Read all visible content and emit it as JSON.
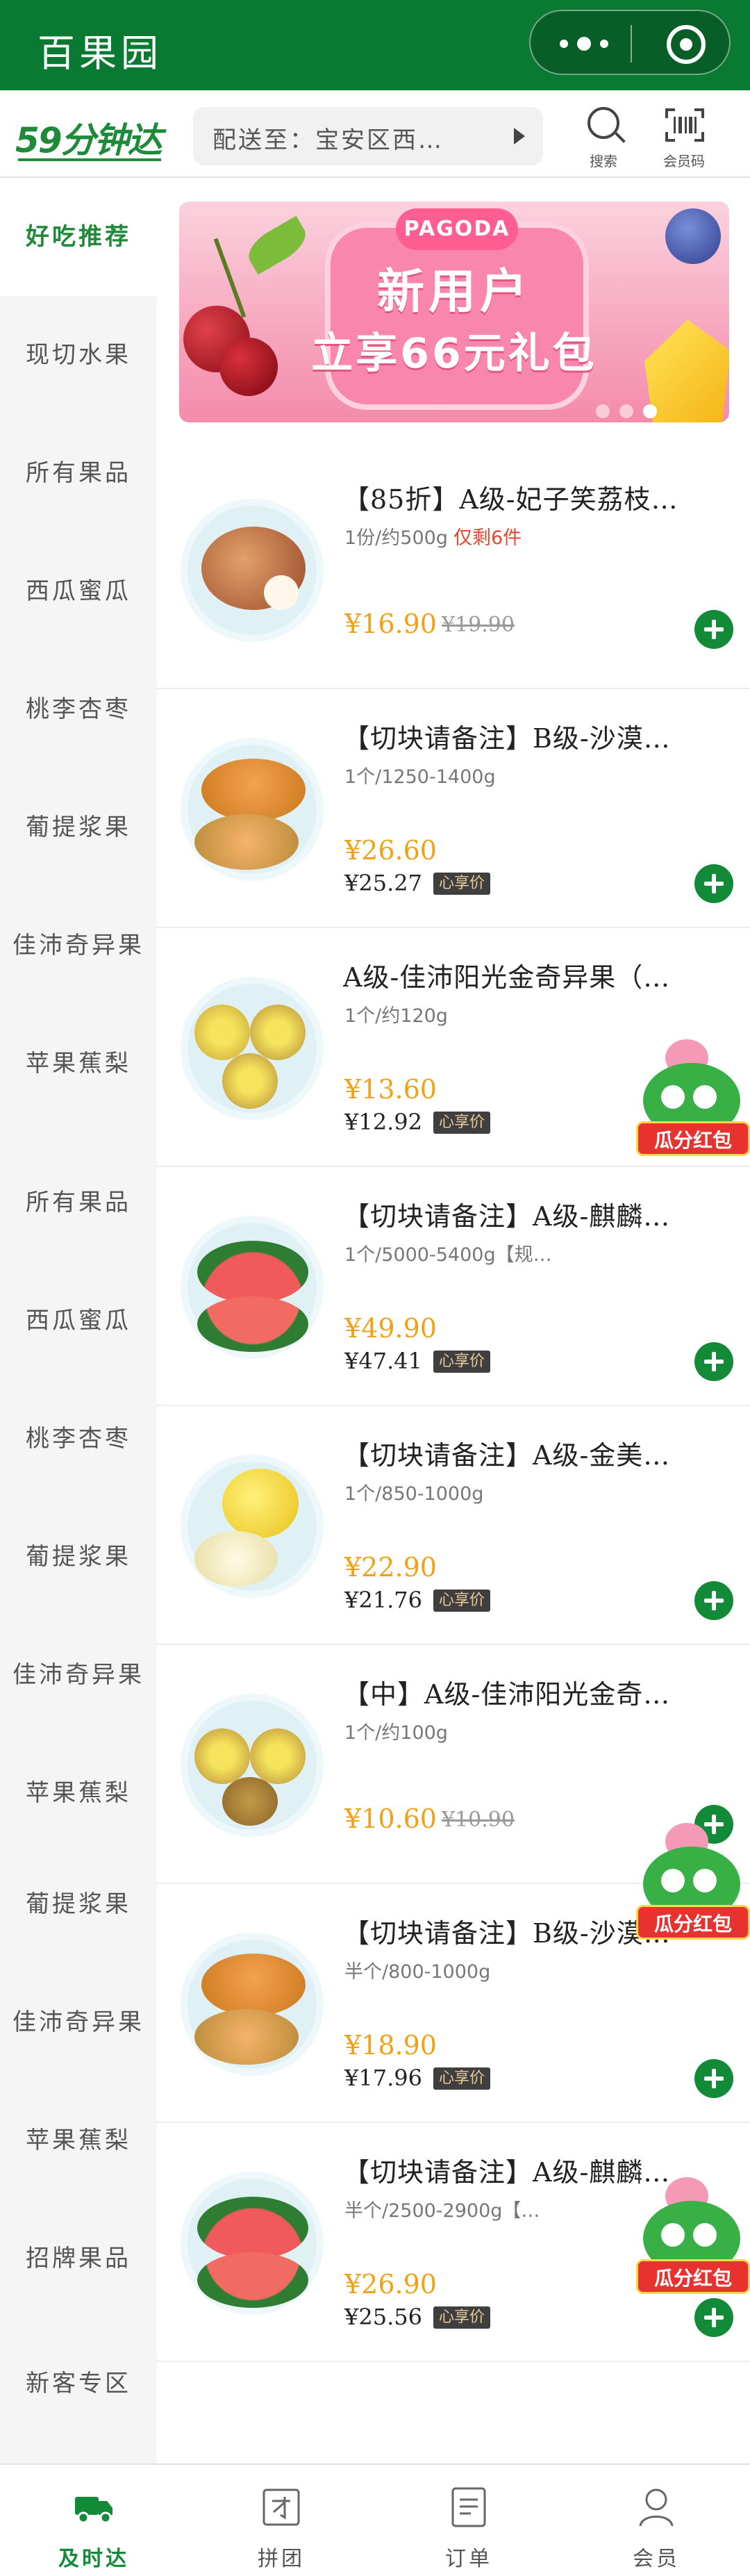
{
  "app": {
    "title": "百果园"
  },
  "header": {
    "brand": "59分钟达",
    "address": "配送至：宝安区西…",
    "search_label": "搜索",
    "member_code_label": "会员码"
  },
  "sidebar": {
    "items": [
      {
        "label": "好吃推荐",
        "active": true
      },
      {
        "label": "现切水果"
      },
      {
        "label": "所有果品"
      },
      {
        "label": "西瓜蜜瓜"
      },
      {
        "label": "桃李杏枣"
      },
      {
        "label": "葡提浆果"
      },
      {
        "label": "佳沛奇异果"
      },
      {
        "label": "苹果蕉梨"
      },
      {
        "label": "所有果品"
      },
      {
        "label": "西瓜蜜瓜"
      },
      {
        "label": "桃李杏枣"
      },
      {
        "label": "葡提浆果"
      },
      {
        "label": "佳沛奇异果"
      },
      {
        "label": "苹果蕉梨"
      },
      {
        "label": "葡提浆果"
      },
      {
        "label": "佳沛奇异果"
      },
      {
        "label": "苹果蕉梨"
      },
      {
        "label": "招牌果品"
      },
      {
        "label": "新客专区"
      }
    ]
  },
  "banner": {
    "brand": "PAGODA",
    "line1": "新用户",
    "line2": "立享66元礼包"
  },
  "products": [
    {
      "title": "【85折】A级-妃子笑荔枝…",
      "spec": "1份/约500g",
      "limit": "仅剩6件",
      "price": "¥16.90",
      "original": "¥19.90"
    },
    {
      "title": "【切块请备注】B级-沙漠…",
      "spec": "1个/1250-1400g",
      "price": "¥26.60",
      "member_price": "¥25.27",
      "member_tag": "心享价"
    },
    {
      "title": "A级-佳沛阳光金奇异果（…",
      "spec": "1个/约120g",
      "price": "¥13.60",
      "member_price": "¥12.92",
      "member_tag": "心享价"
    },
    {
      "title": "【切块请备注】A级-麒麟…",
      "spec": "1个/5000-5400g【规…",
      "price": "¥49.90",
      "member_price": "¥47.41",
      "member_tag": "心享价"
    },
    {
      "title": "【切块请备注】A级-金美…",
      "spec": "1个/850-1000g",
      "price": "¥22.90",
      "member_price": "¥21.76",
      "member_tag": "心享价"
    },
    {
      "title": "【中】A级-佳沛阳光金奇…",
      "spec": "1个/约100g",
      "price": "¥10.60",
      "original": "¥10.90"
    },
    {
      "title": "【切块请备注】B级-沙漠…",
      "spec": "半个/800-1000g",
      "price": "¥18.90",
      "member_price": "¥17.96",
      "member_tag": "心享价"
    },
    {
      "title": "【切块请备注】A级-麒麟…",
      "spec": "半个/2500-2900g【…",
      "price": "¥26.90",
      "member_price": "¥25.56",
      "member_tag": "心享价"
    }
  ],
  "mascot": {
    "badge": "瓜分红包"
  },
  "tabbar": {
    "items": [
      {
        "label": "及时达",
        "active": true
      },
      {
        "label": "拼团"
      },
      {
        "label": "订单"
      },
      {
        "label": "会员"
      }
    ]
  },
  "colors": {
    "brand_green": "#0a7a33",
    "price_orange": "#f0a217",
    "limit_red": "#e4452f"
  }
}
